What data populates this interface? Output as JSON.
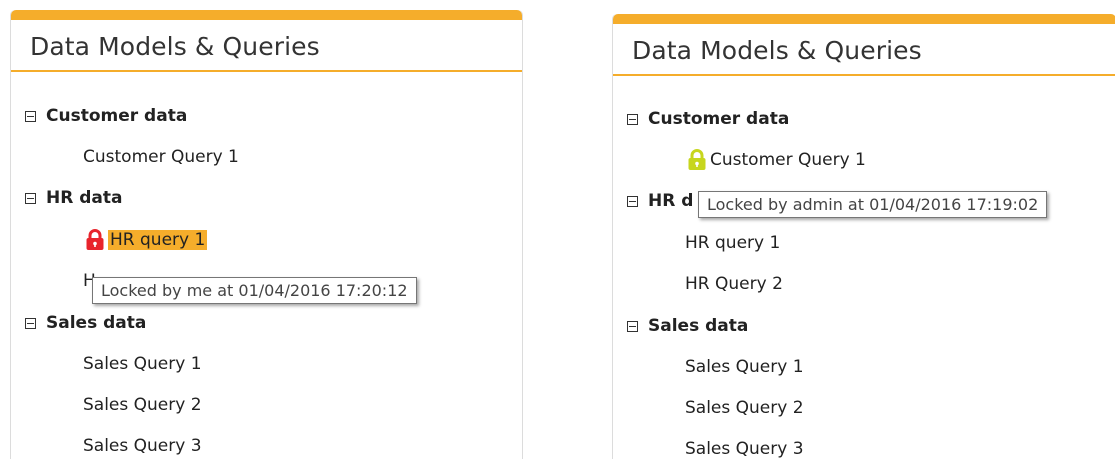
{
  "left_panel": {
    "title": "Data Models & Queries",
    "groups": [
      {
        "label": "Customer data",
        "items": [
          "Customer Query 1"
        ]
      },
      {
        "label": "HR data",
        "items": [
          "HR query 1",
          "H"
        ]
      },
      {
        "label": "Sales data",
        "items": [
          "Sales Query 1",
          "Sales Query 2",
          "Sales Query 3"
        ]
      }
    ],
    "tooltip": "Locked by me at 01/04/2016 17:20:12",
    "lock_color": "#e8242c",
    "selected_color": "#f5ad2b"
  },
  "right_panel": {
    "title": "Data Models & Queries",
    "groups": [
      {
        "label": "Customer data",
        "items": [
          "Customer Query 1"
        ]
      },
      {
        "label": "HR d",
        "items": [
          "HR query 1",
          "HR Query 2"
        ]
      },
      {
        "label": "Sales data",
        "items": [
          "Sales Query 1",
          "Sales Query 2",
          "Sales Query 3"
        ]
      }
    ],
    "tooltip": "Locked by admin at 01/04/2016 17:19:02",
    "lock_color": "#c7d61e"
  },
  "accent_color": "#f5ad2b"
}
